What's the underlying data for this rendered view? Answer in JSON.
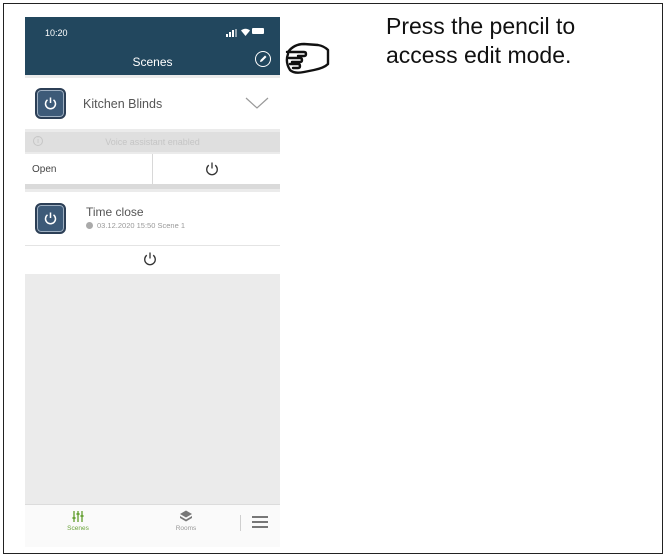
{
  "status_bar": {
    "time": "10:20"
  },
  "header": {
    "title": "Scenes"
  },
  "scenes": [
    {
      "name": "Kitchen Blinds",
      "voice_assistant": "Voice assistant enabled",
      "action_label": "Open"
    },
    {
      "name": "Time close",
      "meta": "03.12.2020  15:50  Scene 1"
    }
  ],
  "tabbar": {
    "scenes_label": "Scenes",
    "rooms_label": "Rooms",
    "active_color": "#6aa33a"
  },
  "instruction": {
    "line1": "Press the pencil to",
    "line2": "access edit mode."
  },
  "colors": {
    "header_bg": "#22475e",
    "scene_button": "#3d5a78"
  }
}
